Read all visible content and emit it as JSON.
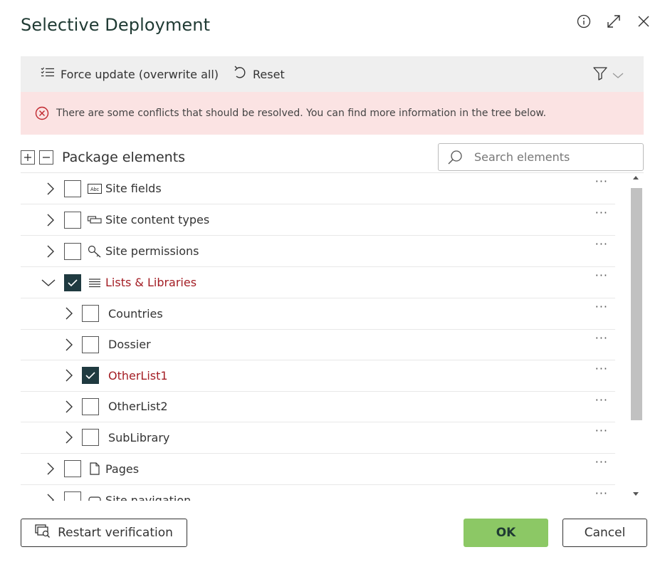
{
  "dialog": {
    "title": "Selective Deployment",
    "icons": [
      "info-icon",
      "expand-icon",
      "close-icon"
    ]
  },
  "toolbar": {
    "force_update_label": "Force update (overwrite all)",
    "reset_label": "Reset",
    "filter_icon": "filter-icon"
  },
  "alert": {
    "text": "There are some conflicts that should be resolved. You can find more information in the tree below.",
    "icon": "error-circle-icon",
    "background": "#fbe3e3"
  },
  "package": {
    "title": "Package elements",
    "search_placeholder": "Search elements"
  },
  "tree": [
    {
      "label": "Site fields",
      "checked": false,
      "expanded": false,
      "icon": "text-field-icon",
      "conflict": false
    },
    {
      "label": "Site content types",
      "checked": false,
      "expanded": false,
      "icon": "content-type-icon",
      "conflict": false
    },
    {
      "label": "Site permissions",
      "checked": false,
      "expanded": false,
      "icon": "key-icon",
      "conflict": false
    },
    {
      "label": "Lists & Libraries",
      "checked": true,
      "expanded": true,
      "icon": "list-icon",
      "conflict": true
    },
    {
      "label": "Countries",
      "checked": false,
      "expanded": false,
      "conflict": false
    },
    {
      "label": "Dossier",
      "checked": false,
      "expanded": false,
      "conflict": false
    },
    {
      "label": "OtherList1",
      "checked": true,
      "expanded": false,
      "conflict": true
    },
    {
      "label": "OtherList2",
      "checked": false,
      "expanded": false,
      "conflict": false
    },
    {
      "label": "SubLibrary",
      "checked": false,
      "expanded": false,
      "conflict": false
    },
    {
      "label": "Pages",
      "checked": false,
      "expanded": false,
      "icon": "page-icon",
      "conflict": false
    },
    {
      "label": "Site navigation",
      "checked": false,
      "expanded": false,
      "icon": "navigation-icon",
      "conflict": false
    }
  ],
  "more_glyph": "···",
  "footer": {
    "restart_label": "Restart verification",
    "ok_label": "OK",
    "cancel_label": "Cancel"
  },
  "colors": {
    "accent_dark": "#1f3a40",
    "ok_green": "#8cc865",
    "conflict_red": "#a31d24"
  }
}
